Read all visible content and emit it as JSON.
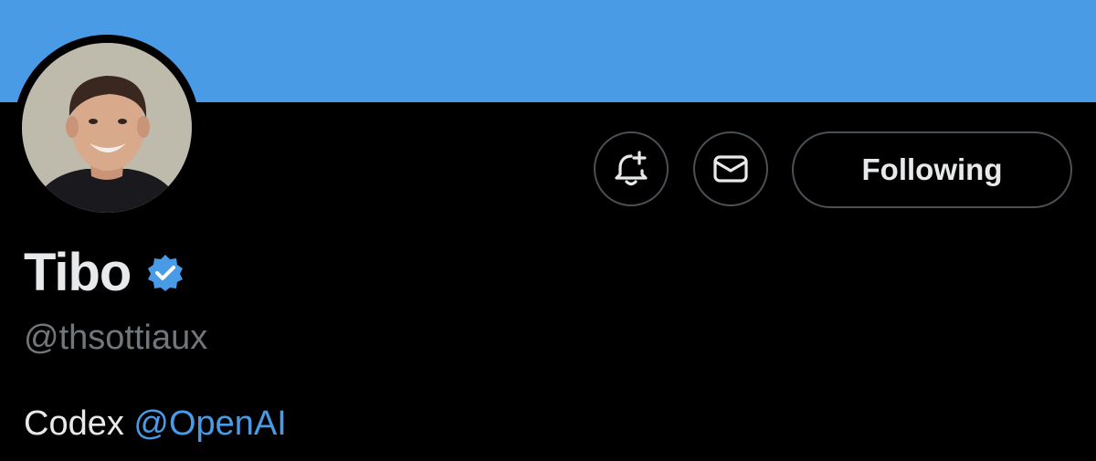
{
  "profile": {
    "display_name": "Tibo",
    "handle": "@thsottiaux",
    "verified": true,
    "bio": {
      "text": "Codex",
      "mention": "@OpenAI"
    }
  },
  "actions": {
    "notify_icon": "bell-plus-icon",
    "message_icon": "envelope-icon",
    "follow_label": "Following"
  },
  "colors": {
    "banner": "#4a9be5",
    "background": "#000000",
    "accent": "#4a9be5",
    "text_primary": "#e7e9ea",
    "text_secondary": "#71767b",
    "button_border": "#4b5055"
  }
}
